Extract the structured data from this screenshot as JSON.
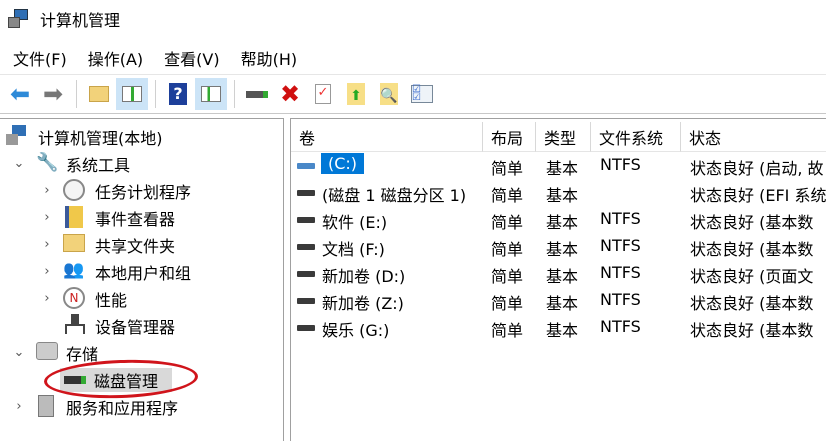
{
  "window": {
    "title": "计算机管理"
  },
  "menu": [
    {
      "label": "文件(F)"
    },
    {
      "label": "操作(A)"
    },
    {
      "label": "查看(V)"
    },
    {
      "label": "帮助(H)"
    }
  ],
  "toolbar": [
    "back-icon",
    "forward-icon",
    "up-folder-icon",
    "show-hide-tree-icon",
    "help-icon",
    "show-action-pane-icon",
    "connect-icon",
    "delete-icon",
    "properties-icon",
    "import-icon",
    "search-icon",
    "checklist-icon"
  ],
  "tree": {
    "root": "计算机管理(本地)",
    "system_tools": "系统工具",
    "task_scheduler": "任务计划程序",
    "event_viewer": "事件查看器",
    "shared_folders": "共享文件夹",
    "local_users": "本地用户和组",
    "performance": "性能",
    "device_manager": "设备管理器",
    "storage": "存储",
    "disk_management": "磁盘管理",
    "services": "服务和应用程序"
  },
  "table": {
    "columns": [
      "卷",
      "布局",
      "类型",
      "文件系统",
      "状态"
    ],
    "rows": [
      {
        "volume": "(C:)",
        "layout": "简单",
        "type": "基本",
        "fs": "NTFS",
        "status": "状态良好 (启动, 故"
      },
      {
        "volume": "(磁盘 1 磁盘分区 1)",
        "layout": "简单",
        "type": "基本",
        "fs": "",
        "status": "状态良好 (EFI 系统"
      },
      {
        "volume": "软件 (E:)",
        "layout": "简单",
        "type": "基本",
        "fs": "NTFS",
        "status": "状态良好 (基本数"
      },
      {
        "volume": "文档 (F:)",
        "layout": "简单",
        "type": "基本",
        "fs": "NTFS",
        "status": "状态良好 (基本数"
      },
      {
        "volume": "新加卷 (D:)",
        "layout": "简单",
        "type": "基本",
        "fs": "NTFS",
        "status": "状态良好 (页面文"
      },
      {
        "volume": "新加卷 (Z:)",
        "layout": "简单",
        "type": "基本",
        "fs": "NTFS",
        "status": "状态良好 (基本数"
      },
      {
        "volume": "娱乐 (G:)",
        "layout": "简单",
        "type": "基本",
        "fs": "NTFS",
        "status": "状态良好 (基本数"
      }
    ]
  },
  "colors": {
    "selection": "#0078d7",
    "annotation": "#d0141b"
  }
}
